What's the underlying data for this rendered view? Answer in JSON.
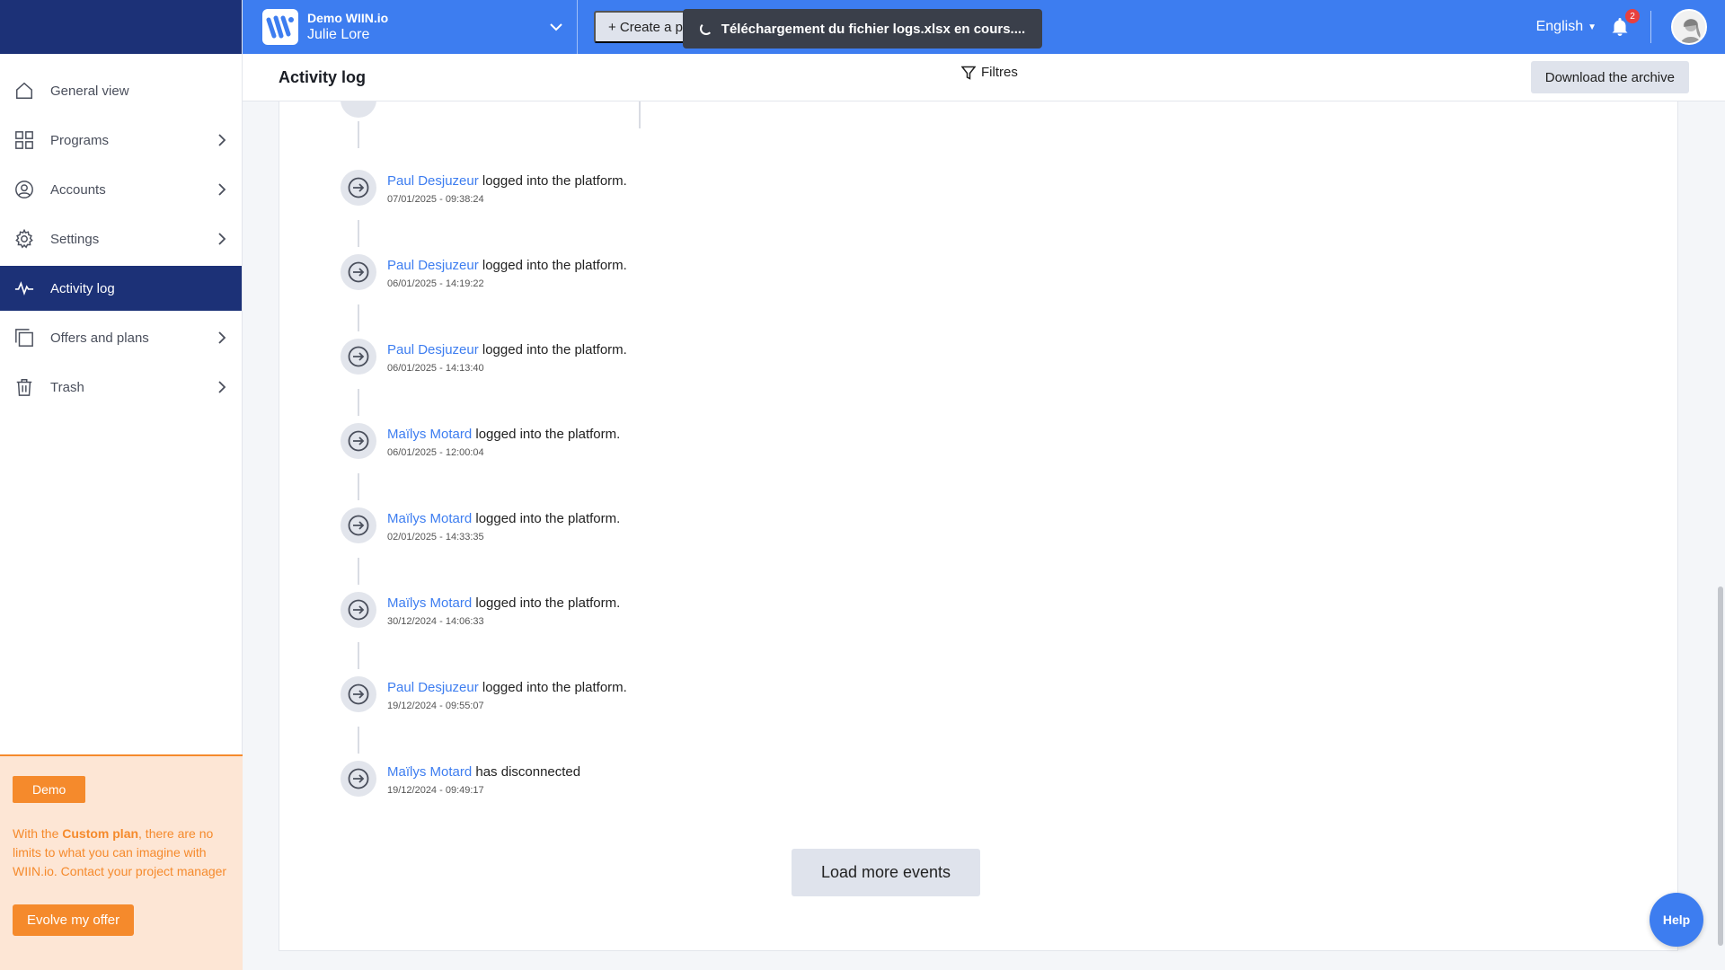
{
  "topbar": {
    "org_name": "Demo WIIN.io",
    "org_user": "Julie Lore",
    "create_label": "+ Create a pr",
    "toast": "Téléchargement du fichier logs.xlsx en cours....",
    "language": "English",
    "notifications_count": "2"
  },
  "sidebar": {
    "items": [
      {
        "label": "General view",
        "icon": "home-icon",
        "chevron": false,
        "active": false
      },
      {
        "label": "Programs",
        "icon": "grid-icon",
        "chevron": true,
        "active": false
      },
      {
        "label": "Accounts",
        "icon": "user-circle-icon",
        "chevron": true,
        "active": false
      },
      {
        "label": "Settings",
        "icon": "gear-icon",
        "chevron": true,
        "active": false
      },
      {
        "label": "Activity log",
        "icon": "pulse-icon",
        "chevron": false,
        "active": true
      },
      {
        "label": "Offers and plans",
        "icon": "copy-icon",
        "chevron": true,
        "active": false
      },
      {
        "label": "Trash",
        "icon": "trash-icon",
        "chevron": true,
        "active": false
      }
    ],
    "promo": {
      "badge": "Demo",
      "text_before": "With the ",
      "text_bold": "Custom plan",
      "text_after": ", there are no limits to what you can imagine with WIIN.io. Contact your project manager",
      "button": "Evolve my offer"
    }
  },
  "header": {
    "title": "Activity log",
    "filters": "Filtres",
    "download": "Download the archive"
  },
  "events": [
    {
      "user": "Paul Desjuzeur",
      "action": " logged into the platform.",
      "date": "07/01/2025 - 09:38:24"
    },
    {
      "user": "Paul Desjuzeur",
      "action": " logged into the platform.",
      "date": "06/01/2025 - 14:19:22"
    },
    {
      "user": "Paul Desjuzeur",
      "action": " logged into the platform.",
      "date": "06/01/2025 - 14:13:40"
    },
    {
      "user": "Maïlys Motard",
      "action": " logged into the platform.",
      "date": "06/01/2025 - 12:00:04"
    },
    {
      "user": "Maïlys Motard",
      "action": " logged into the platform.",
      "date": "02/01/2025 - 14:33:35"
    },
    {
      "user": "Maïlys Motard",
      "action": " logged into the platform.",
      "date": "30/12/2024 - 14:06:33"
    },
    {
      "user": "Paul Desjuzeur",
      "action": " logged into the platform.",
      "date": "19/12/2024 - 09:55:07"
    },
    {
      "user": "Maïlys Motard",
      "action": " has disconnected",
      "date": "19/12/2024 - 09:49:17"
    }
  ],
  "load_more": "Load more events",
  "help": "Help",
  "colors": {
    "navy": "#1c3177",
    "blue": "#3d7df0",
    "orange": "#f58a2c"
  }
}
